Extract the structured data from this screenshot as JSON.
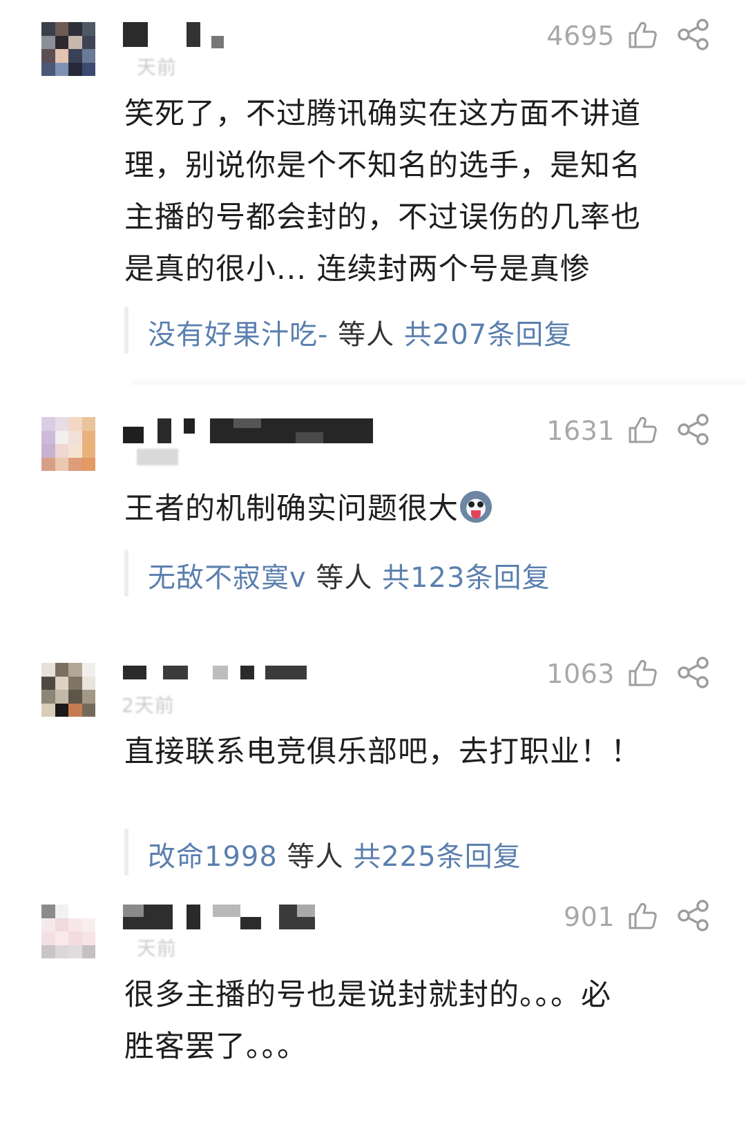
{
  "comments": [
    {
      "time": "天前",
      "likes": "4695",
      "lines": [
        "笑死了，不过腾讯确实在这方面不讲道",
        "理，别说你是个不知名的选手，是知名",
        "主播的号都会封的，不过误伤的几率也",
        "是真的很小... 连续封两个号是真惨"
      ],
      "reply_user": "没有好果汁吃-",
      "reply_middle": " 等人 ",
      "reply_total": "共207条回复"
    },
    {
      "time": "",
      "likes": "1631",
      "lines": [
        "王者的机制确实问题很大"
      ],
      "reply_user": "无敌不寂寞v",
      "reply_middle": " 等人 ",
      "reply_total": "共123条回复"
    },
    {
      "time": "2天前",
      "likes": "1063",
      "lines": [
        "直接联系电竞俱乐部吧，去打职业！！"
      ],
      "reply_user": "改命1998",
      "reply_middle": " 等人 ",
      "reply_total": "共225条回复"
    },
    {
      "time": "天前",
      "likes": "901",
      "lines": [
        "很多主播的号也是说封就封的。。。必",
        "胜客罢了。。。"
      ]
    }
  ],
  "icons": {
    "like": "thumbs-up-icon",
    "share": "share-icon"
  },
  "colors": {
    "reply_link": "#5a7fae",
    "likes_text": "#a8a8a8",
    "body_text": "#1e1e1e"
  }
}
